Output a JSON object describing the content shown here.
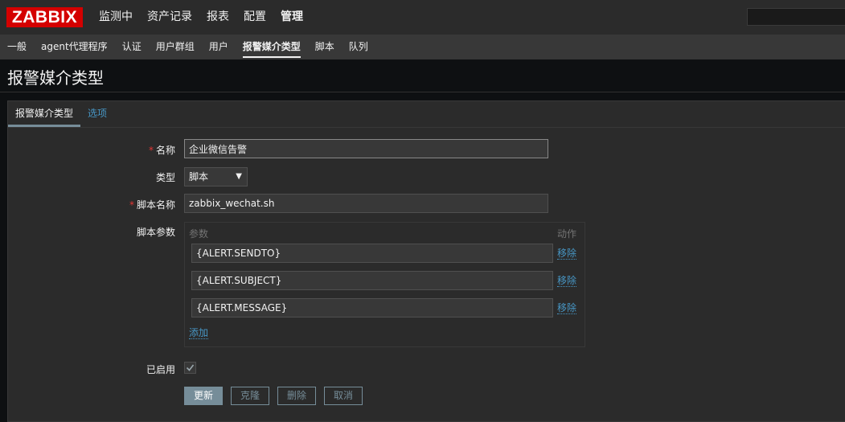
{
  "header": {
    "logo": "ZABBIX",
    "menu": [
      "监测中",
      "资产记录",
      "报表",
      "配置",
      "管理"
    ],
    "active_menu": "管理",
    "search_value": ""
  },
  "submenu": {
    "items": [
      "一般",
      "agent代理程序",
      "认证",
      "用户群组",
      "用户",
      "报警媒介类型",
      "脚本",
      "队列"
    ],
    "active": "报警媒介类型"
  },
  "page": {
    "title": "报警媒介类型"
  },
  "tabs": [
    "报警媒介类型",
    "选项"
  ],
  "form": {
    "name_label": "名称",
    "name_value": "企业微信告警",
    "type_label": "类型",
    "type_value": "脚本",
    "script_label": "脚本名称",
    "script_value": "zabbix_wechat.sh",
    "params_label": "脚本参数",
    "params_col_param": "参数",
    "params_col_action": "动作",
    "params": [
      "{ALERT.SENDTO}",
      "{ALERT.SUBJECT}",
      "{ALERT.MESSAGE}"
    ],
    "remove_label": "移除",
    "add_label": "添加",
    "enabled_label": "已启用",
    "enabled": true,
    "required_mark": "*"
  },
  "buttons": {
    "update": "更新",
    "clone": "克隆",
    "delete": "删除",
    "cancel": "取消"
  },
  "colors": {
    "logo_bg": "#d40000",
    "link": "#4796c4",
    "button": "#768d99",
    "required": "#e33734"
  }
}
